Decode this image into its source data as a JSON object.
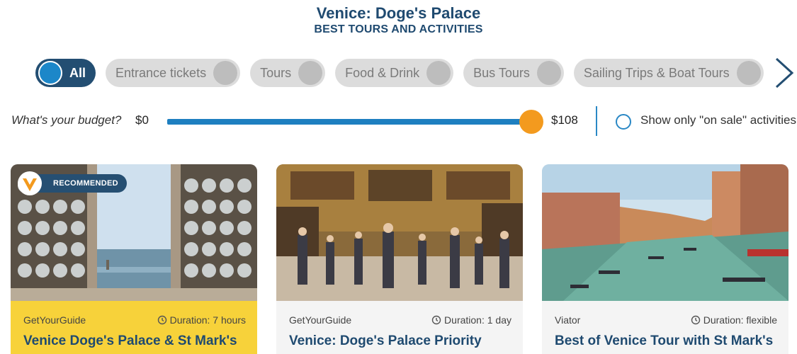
{
  "header": {
    "title": "Venice: Doge's Palace",
    "subtitle": "BEST TOURS AND ACTIVITIES"
  },
  "filters": [
    {
      "label": "All",
      "active": true
    },
    {
      "label": "Entrance tickets",
      "active": false
    },
    {
      "label": "Tours",
      "active": false
    },
    {
      "label": "Food & Drink",
      "active": false
    },
    {
      "label": "Bus Tours",
      "active": false
    },
    {
      "label": "Sailing Trips & Boat Tours",
      "active": false
    }
  ],
  "budget": {
    "question": "What's your budget?",
    "min_label": "$0",
    "max_label": "$108",
    "on_sale_label": "Show only \"on sale\" activities"
  },
  "cards": [
    {
      "provider": "GetYourGuide",
      "duration": "Duration: 7 hours",
      "title": "Venice Doge's Palace & St Mark's",
      "badge": "RECOMMENDED",
      "featured": true,
      "image": "palace-window-view-of-lagoon"
    },
    {
      "provider": "GetYourGuide",
      "duration": "Duration: 1 day",
      "title": "Venice: Doge's Palace Priority",
      "featured": false,
      "image": "doges-palace-golden-hall-with-visitors"
    },
    {
      "provider": "Viator",
      "duration": "Duration: flexible",
      "title": "Best of Venice Tour with St Mark's",
      "featured": false,
      "image": "grand-canal-with-boats"
    }
  ],
  "colors": {
    "brand": "#1f4a70",
    "accent_blue": "#1e7fc0",
    "slider_thumb": "#f39a1e",
    "featured_card": "#f7d23a",
    "chip_bg": "#dcdcdc"
  },
  "icons": {
    "next": "chevron-right-icon",
    "duration": "clock-history-icon",
    "badge": "medal-check-icon"
  }
}
